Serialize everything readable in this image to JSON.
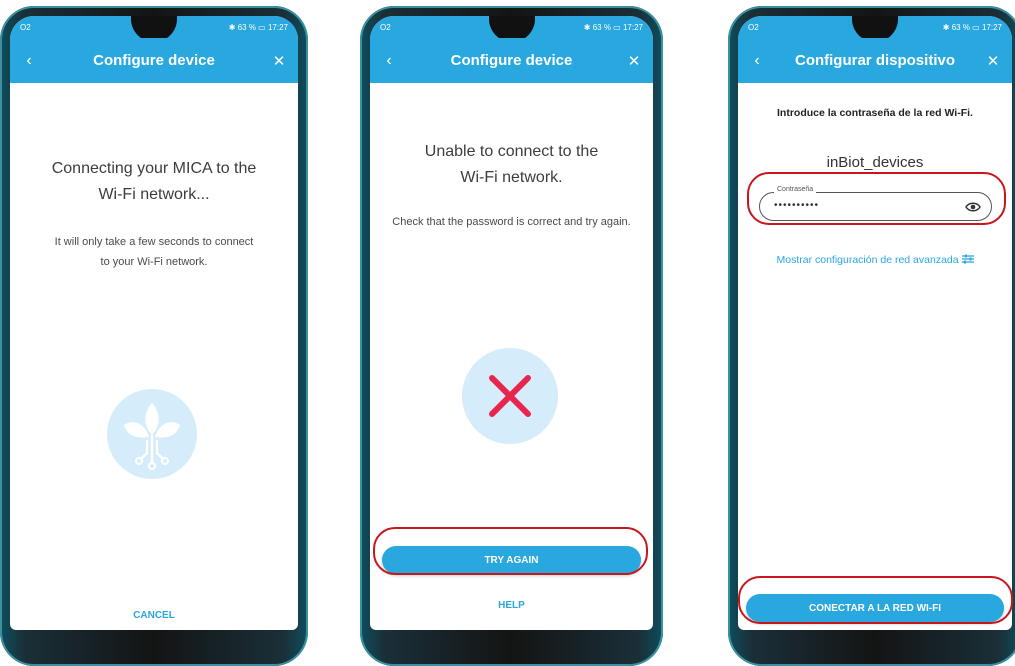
{
  "status_bar": {
    "carrier": "O2",
    "battery": "63 %",
    "time": "17:27"
  },
  "screen1": {
    "title": "Configure device",
    "heading": "Connecting your MICA to the Wi-Fi network...",
    "subtext": "It will only take a few seconds to connect to your Wi-Fi network.",
    "cancel_label": "CANCEL"
  },
  "screen2": {
    "title": "Configure device",
    "heading": "Unable to connect to the Wi-Fi network.",
    "subtext": "Check that the password is correct and try again.",
    "try_again_label": "TRY AGAIN",
    "help_label": "HELP"
  },
  "screen3": {
    "title": "Configurar dispositivo",
    "instruction": "Introduce la contraseña de la red Wi-Fi.",
    "network_name": "inBiot_devices",
    "password_label": "Contraseña",
    "password_value": "••••••••••",
    "advanced_link": "Mostrar configuración de red avanzada",
    "connect_label": "CONECTAR A LA RED WI-FI"
  },
  "colors": {
    "accent": "#29a7df",
    "highlight": "#c8161d",
    "error": "#e8264d",
    "icon_bg": "#d5ecfa"
  },
  "icons": {
    "back": "chevron-left-icon",
    "close": "close-icon",
    "progress": "plant-circuit-icon",
    "error": "x-mark-icon",
    "visibility": "eye-icon",
    "settings": "sliders-icon"
  }
}
